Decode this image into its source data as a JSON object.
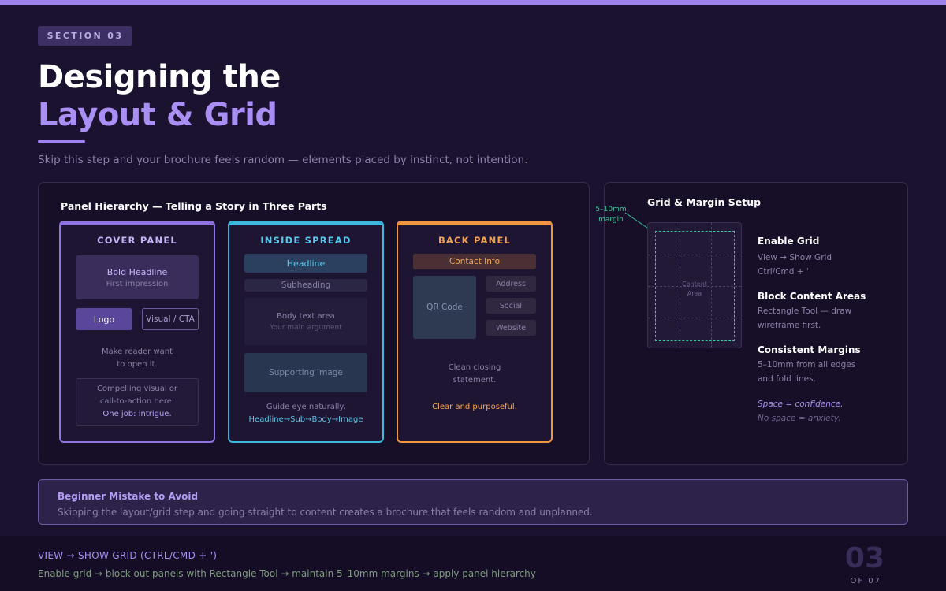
{
  "section_label": "SECTION 03",
  "title": {
    "line1": "Designing the",
    "line2": "Layout & Grid"
  },
  "subtitle": "Skip this step and your brochure feels random — elements placed by instinct, not intention.",
  "hierarchy": {
    "heading": "Panel Hierarchy — Telling a Story in Three Parts",
    "cover": {
      "title": "COVER PANEL",
      "headline_block": {
        "title": "Bold Headline",
        "sub": "First impression"
      },
      "logo": "Logo",
      "visual_cta": "Visual / CTA",
      "note_line1": "Make reader want",
      "note_line2": "to open it.",
      "box_line1": "Compelling visual or",
      "box_line2": "call-to-action here.",
      "box_highlight": "One job: intrigue."
    },
    "inside": {
      "title": "INSIDE SPREAD",
      "headline": "Headline",
      "subheading": "Subheading",
      "body_title": "Body text area",
      "body_sub": "Your main argument",
      "image": "Supporting image",
      "note": "Guide eye naturally.",
      "flow": "Headline→Sub→Body→Image"
    },
    "back": {
      "title": "BACK PANEL",
      "contact": "Contact Info",
      "qr": "QR Code",
      "address": "Address",
      "social": "Social",
      "website": "Website",
      "note_line1": "Clean closing",
      "note_line2": "statement.",
      "highlight": "Clear and purposeful."
    }
  },
  "grid_setup": {
    "heading": "Grid & Margin Setup",
    "margin_label_line1": "5–10mm",
    "margin_label_line2": "margin",
    "content_line1": "Content",
    "content_line2": "Area",
    "steps": [
      {
        "title": "Enable Grid",
        "line1": "View → Show Grid",
        "line2": "Ctrl/Cmd + '"
      },
      {
        "title": "Block Content Areas",
        "line1": "Rectangle Tool — draw",
        "line2": "wireframe first."
      },
      {
        "title": "Consistent Margins",
        "line1": "5–10mm from all edges",
        "line2": "and fold lines."
      }
    ],
    "quote_line1": "Space = confidence.",
    "quote_line2": "No space = anxiety."
  },
  "mistake": {
    "title": "Beginner Mistake to Avoid",
    "text": "Skipping the layout/grid step and going straight to content creates a brochure that feels random and unplanned."
  },
  "footer": {
    "shortcut": "VIEW → SHOW GRID (CTRL/CMD + ')",
    "steps": "Enable grid → block out panels with Rectangle Tool → maintain 5–10mm margins → apply panel hierarchy",
    "page_number": "03",
    "page_of": "OF 07"
  },
  "colors": {
    "accent_purple": "#9f82f2",
    "cyan": "#3db9dc",
    "orange": "#ee9640",
    "green": "#39c79a"
  }
}
